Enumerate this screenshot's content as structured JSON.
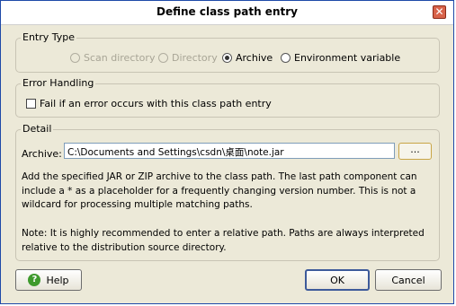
{
  "window": {
    "title": "Define class path entry",
    "close_glyph": "✕"
  },
  "entry_type": {
    "legend": "Entry Type",
    "options": [
      {
        "label": "Scan directory",
        "enabled": false,
        "checked": false
      },
      {
        "label": "Directory",
        "enabled": false,
        "checked": false
      },
      {
        "label": "Archive",
        "enabled": true,
        "checked": true
      },
      {
        "label": "Environment variable",
        "enabled": true,
        "checked": false
      }
    ]
  },
  "error_handling": {
    "legend": "Error Handling",
    "checkbox_label": "Fail if an error occurs with this class path entry",
    "checked": false
  },
  "detail": {
    "legend": "Detail",
    "archive_label": "Archive:",
    "archive_value": "C:\\Documents and Settings\\csdn\\桌面\\note.jar",
    "browse_label": "...",
    "description": "Add the specified JAR or ZIP archive to the class path. The last path component can include a * as a placeholder for a frequently changing version number. This is not a wildcard for processing multiple matching paths.",
    "note": "Note: It is highly recommended to enter a relative path. Paths are always interpreted relative to the distribution source directory."
  },
  "buttons": {
    "help": "Help",
    "ok": "OK",
    "cancel": "Cancel"
  },
  "icons": {
    "help": "help-icon",
    "close": "close-icon"
  },
  "colors": {
    "dialog_bg": "#ece9d8",
    "title_border": "#1f4aa8",
    "help_icon": "#3f9a2d",
    "close_bg": "#d8634a"
  }
}
